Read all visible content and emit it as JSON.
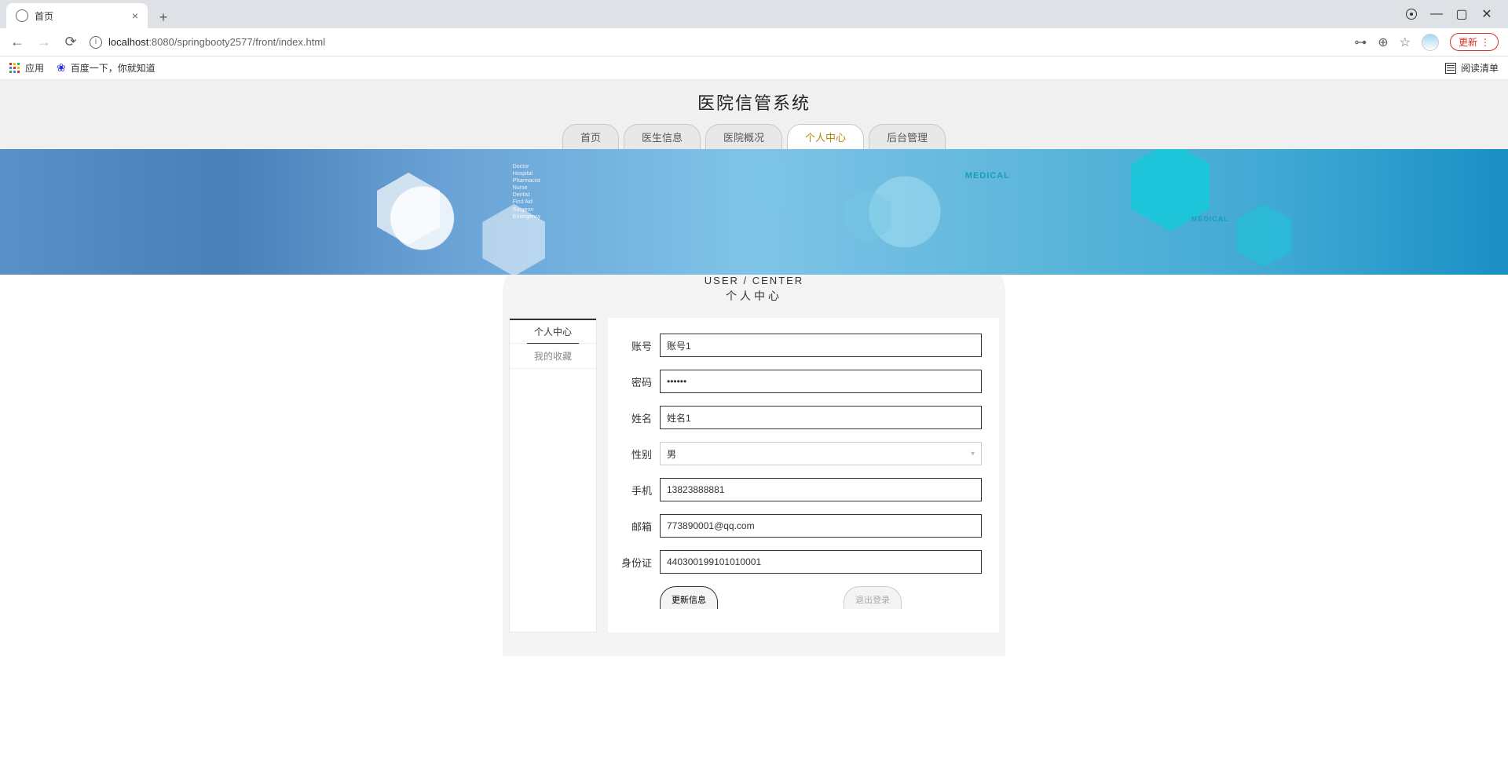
{
  "browser": {
    "tab_title": "首页",
    "url_host": "localhost",
    "url_port": ":8080",
    "url_path": "/springbooty2577/front/index.html",
    "update_label": "更新",
    "bookmarks": {
      "apps": "应用",
      "baidu": "百度一下，你就知道",
      "reading_list": "阅读清单"
    }
  },
  "header": {
    "title": "医院信管系统"
  },
  "nav": {
    "items": [
      "首页",
      "医生信息",
      "医院概况",
      "个人中心",
      "后台管理"
    ]
  },
  "banner": {
    "label1": "MEDICAL",
    "label2": "MEDICAL",
    "hospital_list": "Doctor\nHospital\nPharmacist\nNurse\nDentist\nFirst Aid\nSurgeon\nEmergency"
  },
  "section": {
    "title_en": "USER / CENTER",
    "title_cn": "个人中心"
  },
  "sidebar": {
    "items": [
      "个人中心",
      "我的收藏"
    ]
  },
  "form": {
    "account": {
      "label": "账号",
      "value": "账号1"
    },
    "password": {
      "label": "密码",
      "value": "••••••"
    },
    "name": {
      "label": "姓名",
      "value": "姓名1"
    },
    "gender": {
      "label": "性别",
      "value": "男"
    },
    "phone": {
      "label": "手机",
      "value": "13823888881"
    },
    "email": {
      "label": "邮箱",
      "value": "773890001@qq.com"
    },
    "idcard": {
      "label": "身份证",
      "value": "440300199101010001"
    },
    "actions": {
      "update": "更新信息",
      "logout": "退出登录"
    }
  }
}
